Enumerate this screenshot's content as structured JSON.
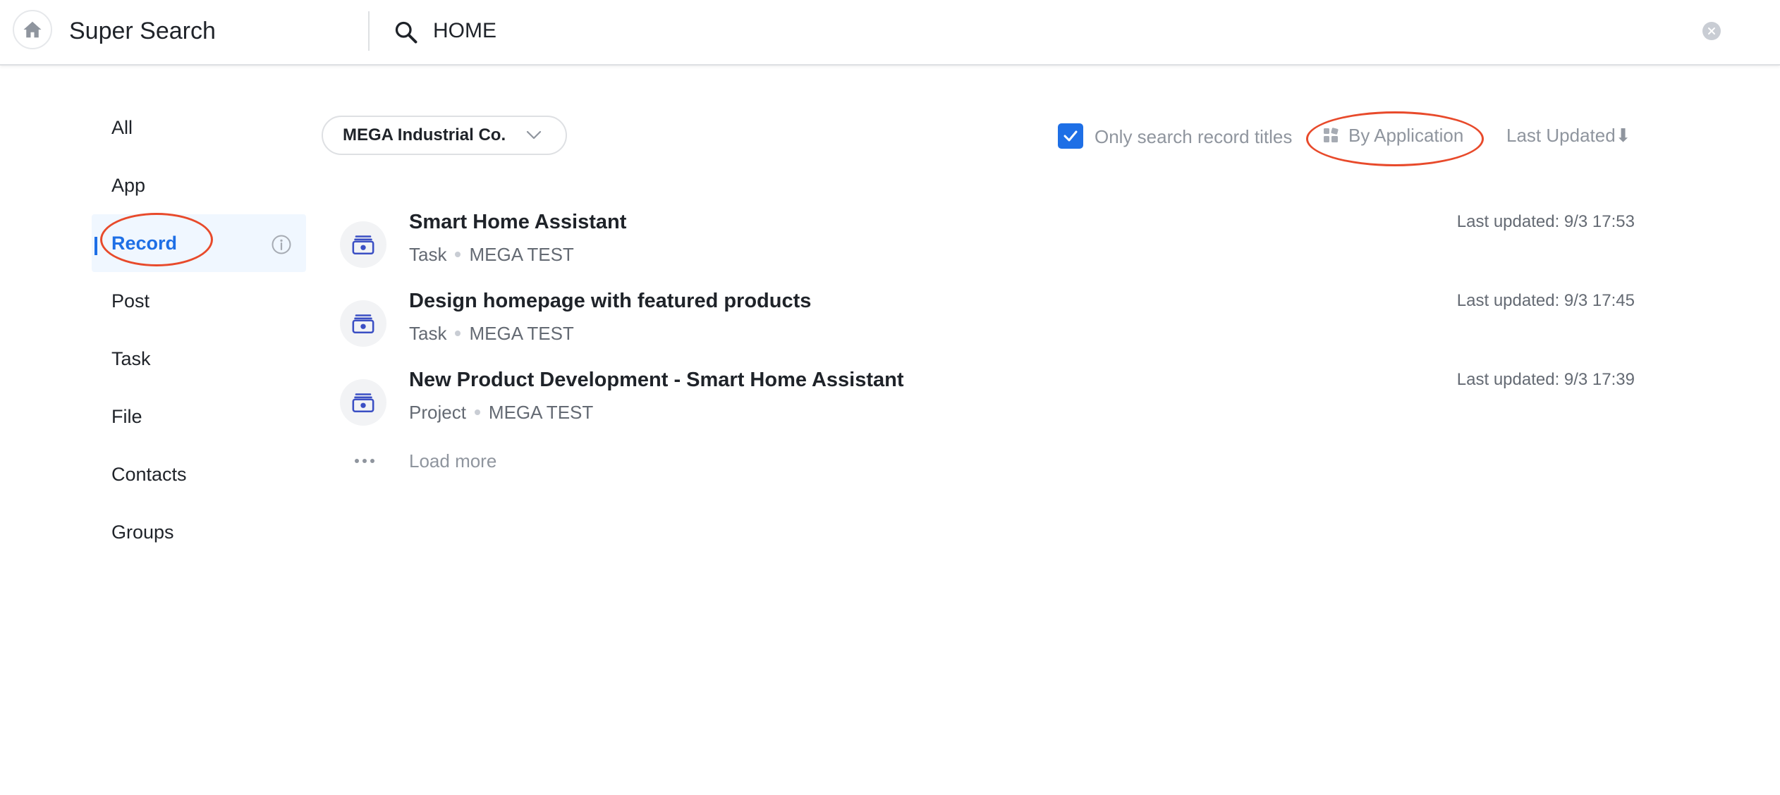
{
  "header": {
    "title": "Super Search",
    "search_value": "HOME"
  },
  "sidebar": {
    "items": [
      {
        "label": "All"
      },
      {
        "label": "App"
      },
      {
        "label": "Record",
        "active": true
      },
      {
        "label": "Post"
      },
      {
        "label": "Task"
      },
      {
        "label": "File"
      },
      {
        "label": "Contacts"
      },
      {
        "label": "Groups"
      }
    ]
  },
  "filters": {
    "company": "MEGA Industrial Co.",
    "only_titles_label": "Only search record titles",
    "only_titles_checked": true,
    "group_by_label": "By Application",
    "sort_label": "Last Updated⬇"
  },
  "results": [
    {
      "title": "Smart Home Assistant",
      "type": "Task",
      "workspace": "MEGA TEST",
      "updated": "Last updated: 9/3 17:53"
    },
    {
      "title": "Design homepage with featured products",
      "type": "Task",
      "workspace": "MEGA TEST",
      "updated": "Last updated: 9/3 17:45"
    },
    {
      "title": "New Product Development - Smart Home Assistant",
      "type": "Project",
      "workspace": "MEGA TEST",
      "updated": "Last updated: 9/3 17:39"
    }
  ],
  "load_more_label": "Load more",
  "colors": {
    "accent": "#1e6fe6",
    "annotation": "#e84a2b",
    "record_icon": "#3b4fc4"
  },
  "icons": {
    "home": "home-icon",
    "search": "search-icon",
    "clear": "clear-icon",
    "info": "info-icon",
    "chevron": "chevron-down-icon",
    "check": "check-icon",
    "grid": "grid-icon",
    "record": "record-icon",
    "more": "more-dots-icon"
  }
}
